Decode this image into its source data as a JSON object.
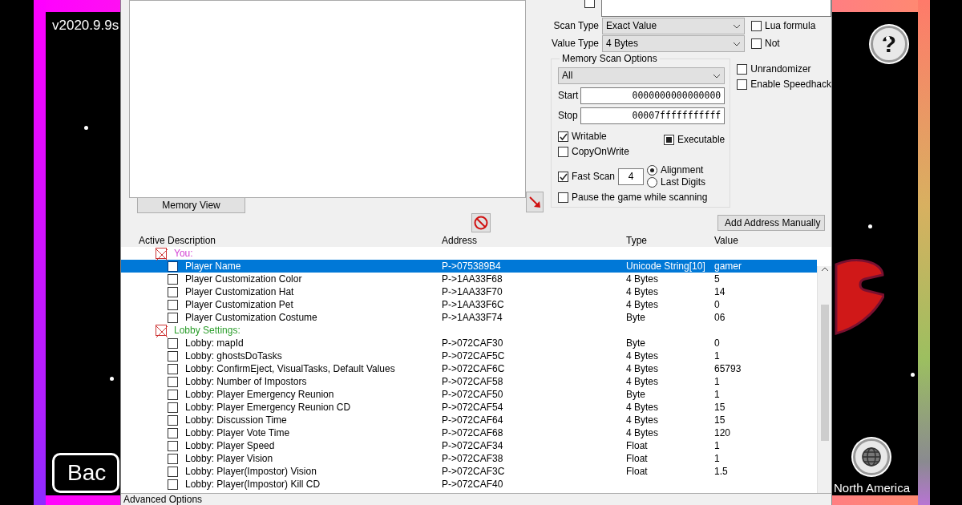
{
  "game": {
    "version": "v2020.9.9s",
    "help_button": "?",
    "back_button": "Bac",
    "region": "North America"
  },
  "cheat_engine": {
    "top_checkbox": {
      "checked": false
    },
    "scan_type": {
      "label": "Scan Type",
      "value": "Exact Value"
    },
    "value_type": {
      "label": "Value Type",
      "value": "4 Bytes"
    },
    "options": [
      {
        "label": "Lua formula",
        "checked": false
      },
      {
        "label": "Not",
        "checked": false
      }
    ],
    "memory_scan_options": {
      "title": "Memory Scan Options",
      "region": "All",
      "start_label": "Start",
      "start": "0000000000000000",
      "stop_label": "Stop",
      "stop": "00007fffffffffff",
      "flags": [
        {
          "label": "Writable",
          "checked": true,
          "indeterminate": false
        },
        {
          "label": "Executable",
          "checked": false,
          "indeterminate": true
        },
        {
          "label": "CopyOnWrite",
          "checked": false,
          "indeterminate": false
        }
      ],
      "fast_scan": {
        "label": "Fast Scan",
        "checked": true,
        "value": "4"
      },
      "alignment": [
        {
          "label": "Alignment",
          "selected": true
        },
        {
          "label": "Last Digits",
          "selected": false
        }
      ],
      "pause": {
        "label": "Pause the game while scanning",
        "checked": false
      }
    },
    "extra_options": [
      {
        "label": "Unrandomizer",
        "checked": false
      },
      {
        "label": "Enable Speedhack",
        "checked": false
      }
    ],
    "memory_view_button": "Memory View",
    "add_address_button": "Add Address Manually",
    "table": {
      "columns": [
        "Active",
        "Description",
        "Address",
        "Type",
        "Value"
      ],
      "rows": [
        {
          "description": "You:",
          "kind": "group",
          "color": "#d23fd2",
          "selected": false,
          "children": [
            {
              "description": "Player Name",
              "active": false,
              "selected": true,
              "address": "P->075389B4",
              "type": "Unicode String[10]",
              "value": "gamer"
            },
            {
              "description": "Player Customization Color",
              "active": false,
              "selected": false,
              "address": "P->1AA33F68",
              "type": "4 Bytes",
              "value": "5"
            },
            {
              "description": "Player Customization Hat",
              "active": false,
              "selected": false,
              "address": "P->1AA33F70",
              "type": "4 Bytes",
              "value": "14"
            },
            {
              "description": "Player Customization Pet",
              "active": false,
              "selected": false,
              "address": "P->1AA33F6C",
              "type": "4 Bytes",
              "value": "0"
            },
            {
              "description": "Player Customization Costume",
              "active": false,
              "selected": false,
              "address": "P->1AA33F74",
              "type": "Byte",
              "value": "06"
            }
          ]
        },
        {
          "description": "Lobby Settings:",
          "kind": "group",
          "color": "#2a9d2a",
          "selected": false,
          "children": [
            {
              "description": "Lobby: mapId",
              "active": false,
              "selected": false,
              "address": "P->072CAF30",
              "type": "Byte",
              "value": "0"
            },
            {
              "description": "Lobby: ghostsDoTasks",
              "active": false,
              "selected": false,
              "address": "P->072CAF5C",
              "type": "4 Bytes",
              "value": "1"
            },
            {
              "description": "Lobby: ConfirmEject, VisualTasks, Default Values",
              "active": false,
              "selected": false,
              "address": "P->072CAF6C",
              "type": "4 Bytes",
              "value": "65793"
            },
            {
              "description": "Lobby: Number of Impostors",
              "active": false,
              "selected": false,
              "address": "P->072CAF58",
              "type": "4 Bytes",
              "value": "1"
            },
            {
              "description": "Lobby: Player Emergency Reunion",
              "active": false,
              "selected": false,
              "address": "P->072CAF50",
              "type": "Byte",
              "value": "1"
            },
            {
              "description": "Lobby: Player Emergency Reunion CD",
              "active": false,
              "selected": false,
              "address": "P->072CAF54",
              "type": "4 Bytes",
              "value": "15"
            },
            {
              "description": "Lobby: Discussion Time",
              "active": false,
              "selected": false,
              "address": "P->072CAF64",
              "type": "4 Bytes",
              "value": "15"
            },
            {
              "description": "Lobby: Player Vote Time",
              "active": false,
              "selected": false,
              "address": "P->072CAF68",
              "type": "4 Bytes",
              "value": "120"
            },
            {
              "description": "Lobby: Player Speed",
              "active": false,
              "selected": false,
              "address": "P->072CAF34",
              "type": "Float",
              "value": "1"
            },
            {
              "description": "Lobby: Player Vision",
              "active": false,
              "selected": false,
              "address": "P->072CAF38",
              "type": "Float",
              "value": "1"
            },
            {
              "description": "Lobby: Player(Impostor) Vision",
              "active": false,
              "selected": false,
              "address": "P->072CAF3C",
              "type": "Float",
              "value": "1.5"
            },
            {
              "description": "Lobby: Player(Impostor) Kill CD",
              "active": false,
              "selected": false,
              "address": "P->072CAF40"
            }
          ]
        }
      ]
    },
    "advanced_options": "Advanced Options"
  }
}
